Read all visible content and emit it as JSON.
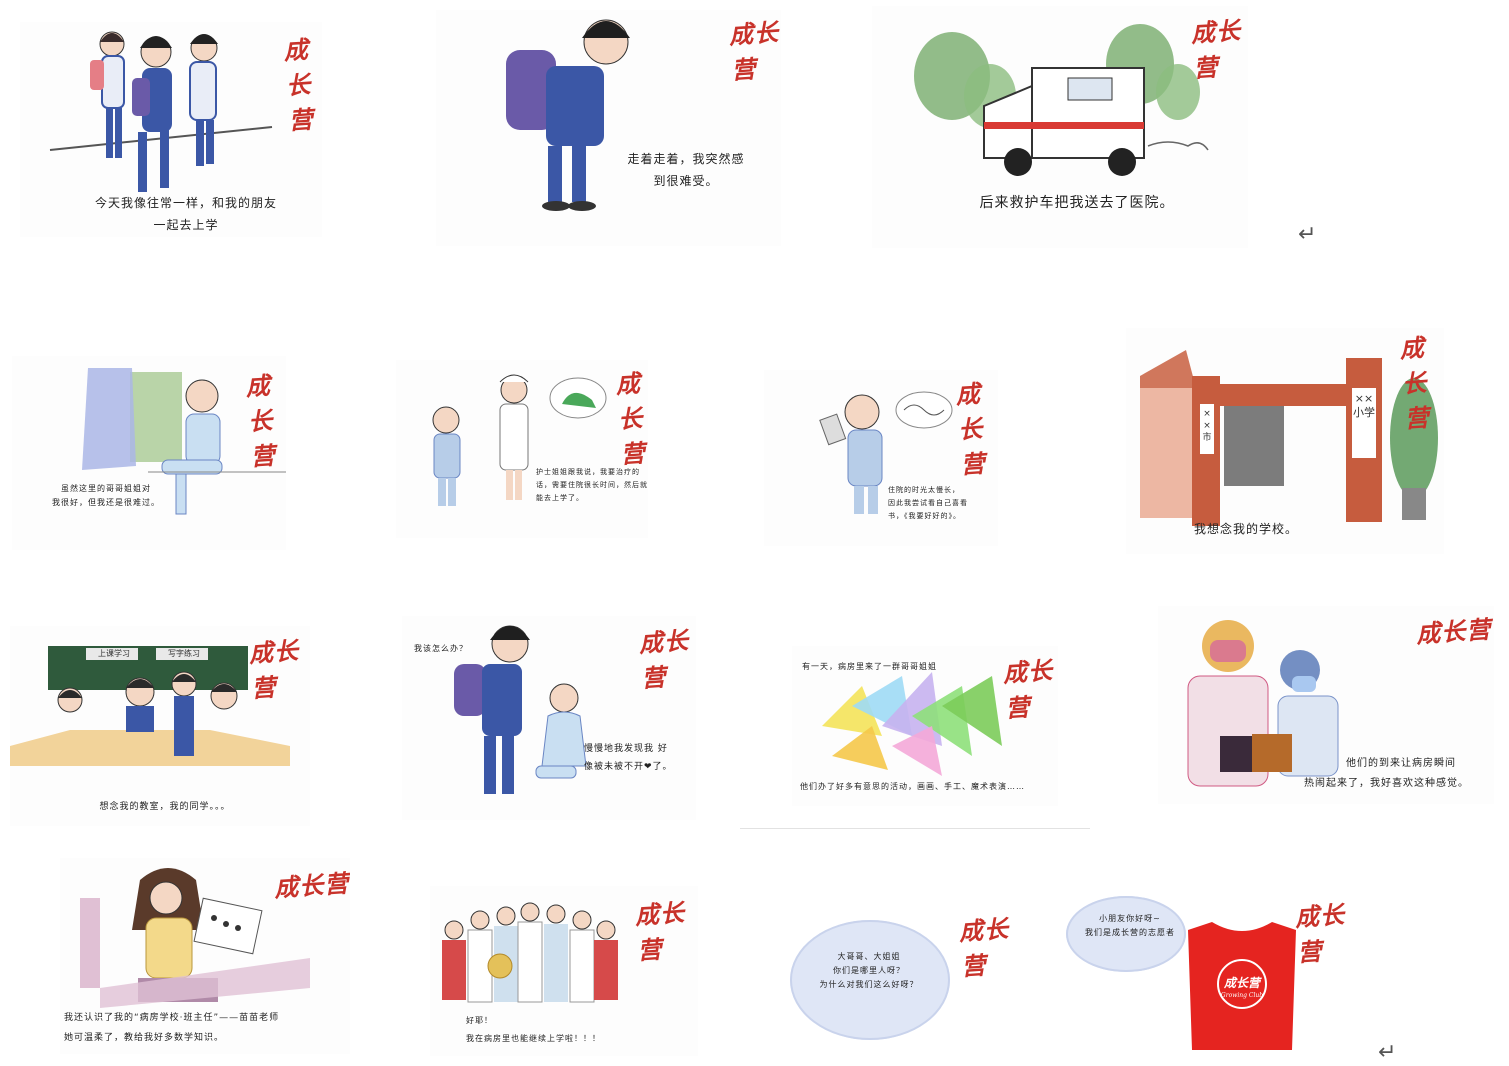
{
  "brand_logo": "成长营",
  "return_mark": "↵",
  "panels": [
    {
      "caption_lines": [
        "今天我像往常一样，和我的朋友",
        "一起去上学"
      ]
    },
    {
      "caption_lines": [
        "走着走着，我突然感",
        "到很难受。"
      ]
    },
    {
      "caption_lines": [
        "后来救护车把我送去了医院。"
      ]
    },
    {
      "caption_lines": [
        "虽然这里的哥哥姐姐对",
        "我很好，但我还是很难过。"
      ]
    },
    {
      "caption_lines": [
        "护士姐姐跟我说，我要治疗的",
        "话，需要住院很长时间，然后就",
        "能去上学了。"
      ]
    },
    {
      "caption_lines": [
        "住院的时光太慢长，",
        "因此我尝试看自己喜看",
        "书，《我要好好的》。"
      ]
    },
    {
      "caption_lines": [
        "我想念我的学校。"
      ],
      "sign_text": "××小学",
      "sign_text_left": "××市"
    },
    {
      "caption_lines": [
        "想念我的教室，我的同学。。。"
      ],
      "board_left": "上课学习",
      "board_right": "写字练习"
    },
    {
      "caption_lines": [
        "我该怎么办？"
      ],
      "caption2_lines": [
        "慢慢地我发现我 好",
        "像被未被不开❤了。"
      ]
    },
    {
      "caption_lines": [
        "有一天，病房里来了一群哥哥姐姐"
      ],
      "caption2_lines": [
        "他们办了好多有意思的活动，画画、手工、魔术表演……"
      ]
    },
    {
      "caption_lines": [
        "他们的到来让病房瞬间",
        "热闹起来了，我好喜欢这种感觉。"
      ]
    },
    {
      "caption_lines": [
        "我还认识了我的“病房学校·班主任”——苗苗老师",
        "她可温柔了，教给我好多数学知识。"
      ]
    },
    {
      "caption_lines": [
        "好耶！"
      ],
      "caption2_lines": [
        "我在病房里也能继续上学啦！！！"
      ]
    },
    {
      "caption_lines": [
        "大哥哥、大姐姐",
        "你们是哪里人呀？",
        "为什么对我们这么好呀？"
      ]
    },
    {
      "caption_lines": [
        "小朋友你好呀~",
        "我们是成长营的志愿者"
      ],
      "vest_text": "成长营",
      "vest_sub": "Growing Club"
    }
  ],
  "colors": {
    "logo": "#c8322a",
    "uniform_blue": "#3b57a6",
    "vest_red": "#e52420",
    "cloud": "#dfe6f6"
  }
}
